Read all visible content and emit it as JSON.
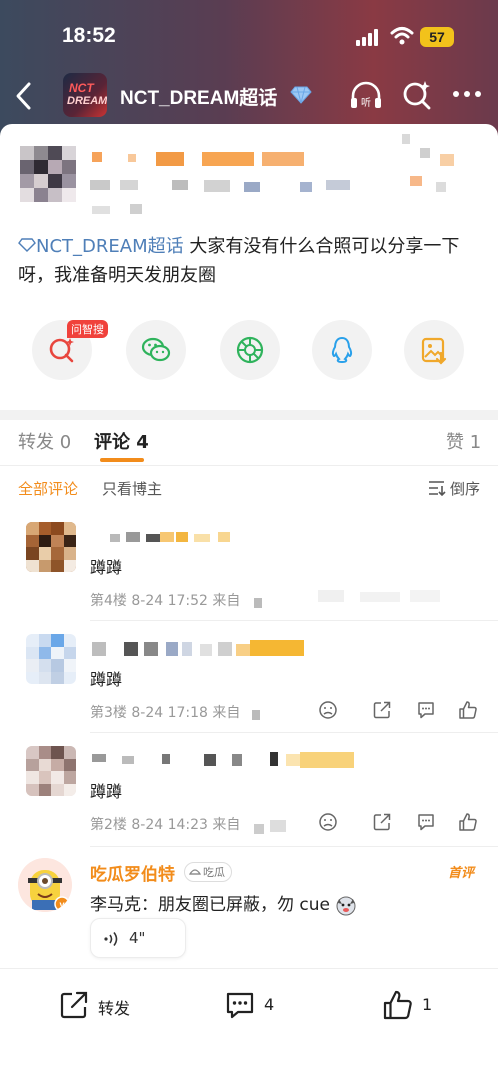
{
  "status": {
    "time": "18:52",
    "battery": "57"
  },
  "nav": {
    "title": "NCT_DREAM超话",
    "avatar_line1": "NCT",
    "avatar_line2": "DREAM"
  },
  "post": {
    "topic_tag": "NCT_DREAM超话",
    "body": " 大家有没有什么合照可以分享一下呀，我准备明天发朋友圈",
    "ask_badge": "问智搜"
  },
  "tabs": {
    "repost": "转发 0",
    "comment": "评论 4",
    "like": "赞 1"
  },
  "filter": {
    "all": "全部评论",
    "author_only": "只看博主",
    "sort": "倒序"
  },
  "comments": [
    {
      "text": "蹲蹲",
      "meta": "第4楼  8-24 17:52  来自"
    },
    {
      "text": "蹲蹲",
      "meta": "第3楼  8-24 17:18  来自"
    },
    {
      "text": "蹲蹲",
      "meta": "第2楼  8-24 14:23  来自"
    }
  ],
  "hot_comment": {
    "name": "吃瓜罗伯特",
    "tag": "吃瓜",
    "badge": "首评",
    "text": "李马克：朋友圈已屏蔽，勿 cue",
    "voice_length": "4\""
  },
  "bottom_bar": {
    "repost": "转发",
    "comment_count": "4",
    "like_count": "1"
  },
  "colors": {
    "accent": "#f28c1b",
    "link": "#4f7fb8",
    "header_start": "#3c4a5e",
    "header_end": "#8a3a44"
  }
}
